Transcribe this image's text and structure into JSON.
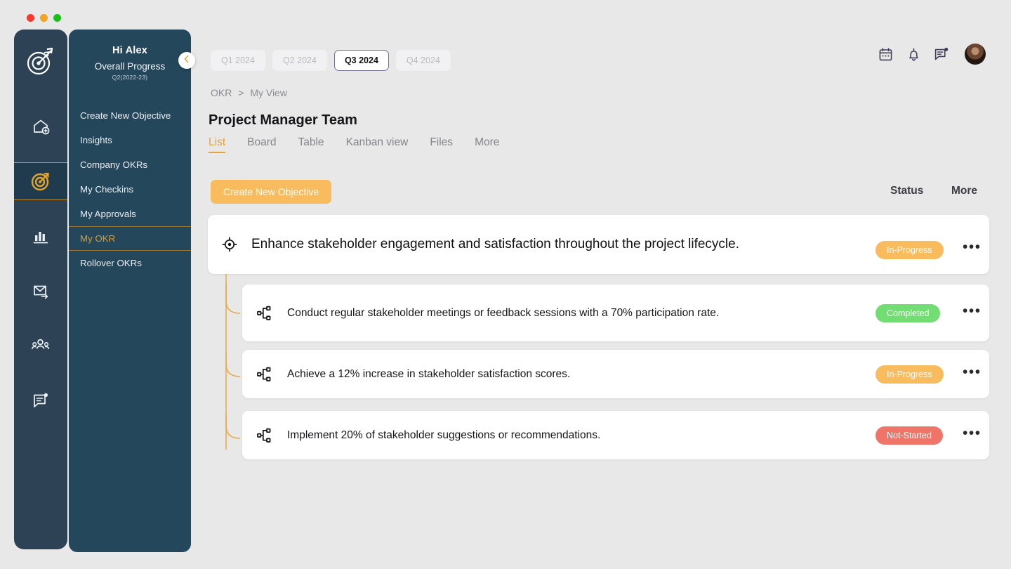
{
  "window": {
    "traffic_lights": [
      "red",
      "amber",
      "green"
    ]
  },
  "rail": {
    "logo_icon": "target-logo-icon",
    "items": [
      {
        "icon": "home-add-icon",
        "name": "home",
        "active": false
      },
      {
        "icon": "target-icon",
        "name": "okr",
        "active": true
      },
      {
        "icon": "bar-chart-icon",
        "name": "analytics",
        "active": false
      },
      {
        "icon": "mail-send-icon",
        "name": "mail",
        "active": false
      },
      {
        "icon": "users-icon",
        "name": "people",
        "active": false
      },
      {
        "icon": "message-note-icon",
        "name": "messages",
        "active": false
      }
    ]
  },
  "sidebar": {
    "greeting": "Hi Alex",
    "subtitle": "Overall Progress",
    "quarter_label": "Q2(2022-23)",
    "collapse_icon": "chevron-left-icon",
    "items": [
      {
        "label": "Create New Objective",
        "active": false
      },
      {
        "label": "Insights",
        "active": false
      },
      {
        "label": "Company OKRs",
        "active": false
      },
      {
        "label": "My  Checkins",
        "active": false
      },
      {
        "label": "My Approvals",
        "active": false
      },
      {
        "label": "My OKR",
        "active": true
      },
      {
        "label": "Rollover OKRs",
        "active": false
      }
    ]
  },
  "header": {
    "icons": [
      {
        "name": "calendar-icon"
      },
      {
        "name": "bell-icon"
      },
      {
        "name": "message-icon"
      }
    ],
    "avatar_name": "user-avatar"
  },
  "quarters": [
    {
      "label": "Q1 2024",
      "active": false
    },
    {
      "label": "Q2 2024",
      "active": false
    },
    {
      "label": "Q3 2024",
      "active": true
    },
    {
      "label": "Q4 2024",
      "active": false
    }
  ],
  "breadcrumb": {
    "root": "OKR",
    "separator": ">",
    "current": "My View"
  },
  "page_title": "Project Manager Team",
  "view_tabs": [
    {
      "label": "List",
      "active": true
    },
    {
      "label": "Board",
      "active": false
    },
    {
      "label": "Table",
      "active": false
    },
    {
      "label": "Kanban view",
      "active": false
    },
    {
      "label": "Files",
      "active": false
    },
    {
      "label": "More",
      "active": false
    }
  ],
  "actions": {
    "create_objective_label": "Create New Objective",
    "column_status": "Status",
    "column_more": "More"
  },
  "objective": {
    "icon": "target-crosshair-icon",
    "text": "Enhance stakeholder engagement and satisfaction throughout the project lifecycle.",
    "status": "In-Progress",
    "status_color": "#f8bc5e",
    "menu_icon": "kebab-menu-icon"
  },
  "key_results": [
    {
      "icon": "hierarchy-icon",
      "text": "Conduct regular stakeholder meetings or feedback sessions with a 70% participation rate.",
      "status": "Completed",
      "status_color": "#72dd72",
      "menu_icon": "kebab-menu-icon"
    },
    {
      "icon": "hierarchy-icon",
      "text": "Achieve a 12% increase in stakeholder satisfaction scores.",
      "status": "In-Progress",
      "status_color": "#f8bc5e",
      "menu_icon": "kebab-menu-icon"
    },
    {
      "icon": "hierarchy-icon",
      "text": "Implement 20% of stakeholder suggestions or recommendations.",
      "status": "Not-Started",
      "status_color": "#ef7568",
      "menu_icon": "kebab-menu-icon"
    }
  ],
  "theme": {
    "accent": "#e2a33c",
    "sidebar_bg": "#24475c",
    "rail_bg": "#2d4355",
    "page_bg": "#e8e8e8"
  }
}
